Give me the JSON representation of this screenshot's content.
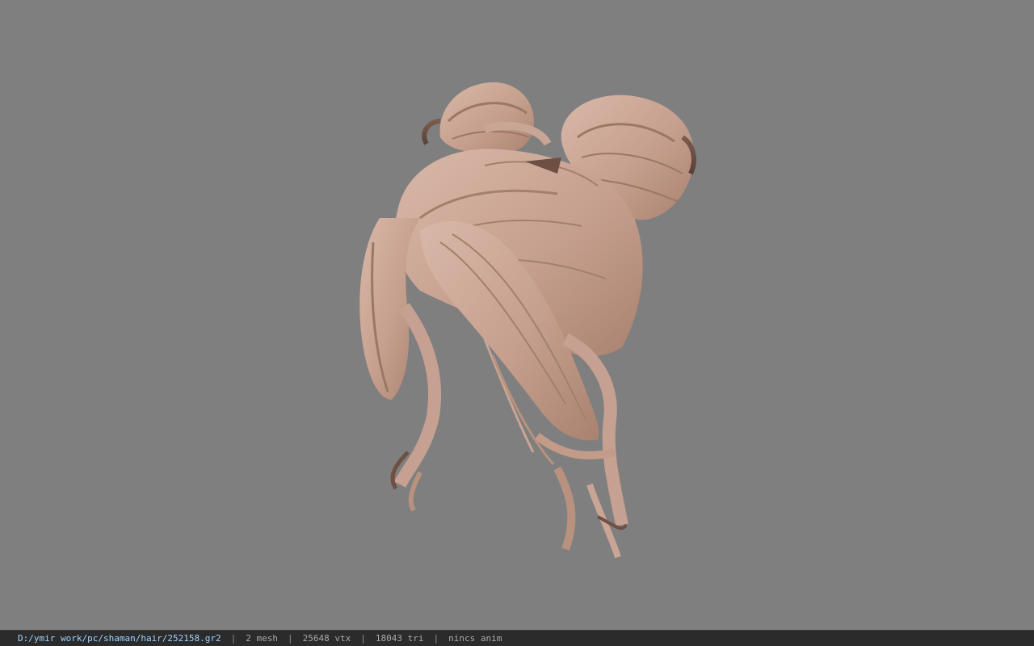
{
  "status": {
    "file_path": "D:/ymir work/pc/shaman/hair/252158.gr2",
    "mesh": "2 mesh",
    "vertices": "25648 vtx",
    "triangles": "18043 tri",
    "anim": "nincs anim",
    "separator": "|"
  },
  "colors": {
    "background": "#7f7f7f",
    "statusbar": "#2b2b2b",
    "hair_base": "#c9a493",
    "hair_shadow": "#6b4f46",
    "path_text": "#9fd3ff"
  },
  "viewport": {
    "model_name": "hair-model-icon"
  }
}
